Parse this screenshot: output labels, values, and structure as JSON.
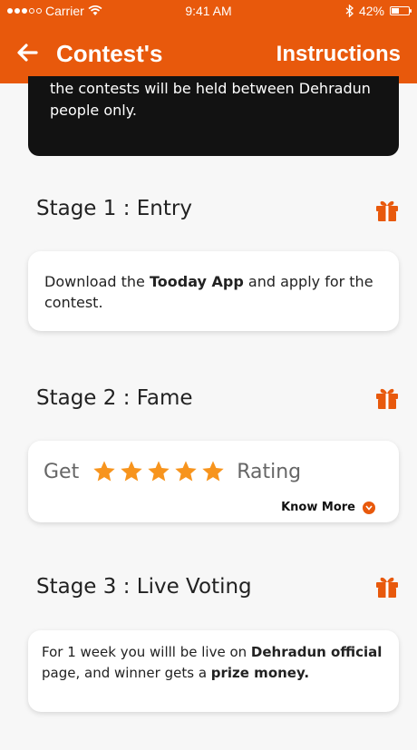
{
  "status_bar": {
    "carrier": "Carrier",
    "time": "9:41 AM",
    "battery": "42%",
    "battery_level": 0.42
  },
  "app_bar": {
    "title": "Contest's",
    "instructions_label": "Instructions"
  },
  "info_card": {
    "text_line1": "the contests will be held between Dehradun",
    "text_line2": "people only."
  },
  "stages": [
    {
      "title": "Stage 1 : Entry",
      "desc_parts": [
        "Download the ",
        "Tooday App",
        " and apply for the contest."
      ]
    },
    {
      "title": "Stage 2 : Fame",
      "get_label": "Get",
      "rating_label": "Rating",
      "stars": 5,
      "know_more": "Know More"
    },
    {
      "title": "Stage 3 : Live Voting",
      "desc_parts": [
        "For 1 week  you willl be live on ",
        "Dehradun official",
        " page, and winner gets a ",
        "prize money."
      ]
    }
  ],
  "colors": {
    "accent": "#e8590c",
    "star": "#f7941d"
  }
}
